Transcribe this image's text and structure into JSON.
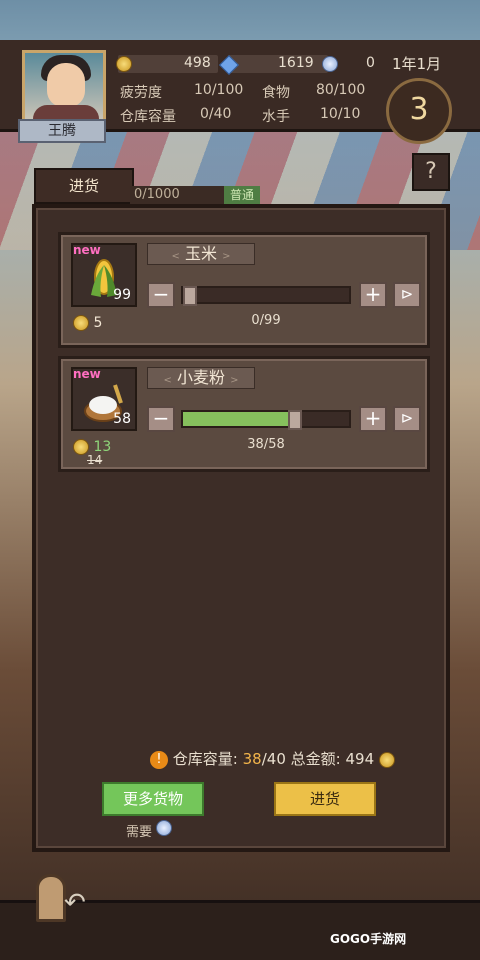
{
  "player": {
    "name": "王腾"
  },
  "resources": {
    "coins": "498",
    "gems": "1619",
    "medals": "0"
  },
  "date": "1年1月",
  "day": "3",
  "stats": {
    "fatigue_label": "疲劳度",
    "fatigue_value": "10/100",
    "food_label": "食物",
    "food_value": "80/100",
    "warehouse_label": "仓库容量",
    "warehouse_value": "0/40",
    "sailor_label": "水手",
    "sailor_value": "10/10"
  },
  "help_button": "?",
  "tab": {
    "label": "进货"
  },
  "capacity_strip": {
    "text": "0/1000",
    "level": "普通"
  },
  "items": [
    {
      "tag": "new",
      "icon": "corn-icon",
      "qty": "99",
      "price": "5",
      "name": "玉米",
      "progress": 0,
      "count": "0/99"
    },
    {
      "tag": "new",
      "icon": "flour-icon",
      "qty": "58",
      "price": "13",
      "old_price": "14",
      "name": "小麦粉",
      "progress": 38,
      "count": "38/58"
    }
  ],
  "summary": {
    "warehouse_label": "仓库容量:",
    "warehouse_current": "38",
    "warehouse_total": "/40",
    "total_label": "总金额:",
    "total_value": "494"
  },
  "buttons": {
    "more_goods": "更多货物",
    "purchase": "进货",
    "need_label": "需要"
  },
  "watermark": "GOGO手游网",
  "colors": {
    "green_button": "#74c65a",
    "yellow_button": "#ecc048",
    "progress_fill": "#86c05d",
    "new_tag": "#ff6fc1"
  }
}
